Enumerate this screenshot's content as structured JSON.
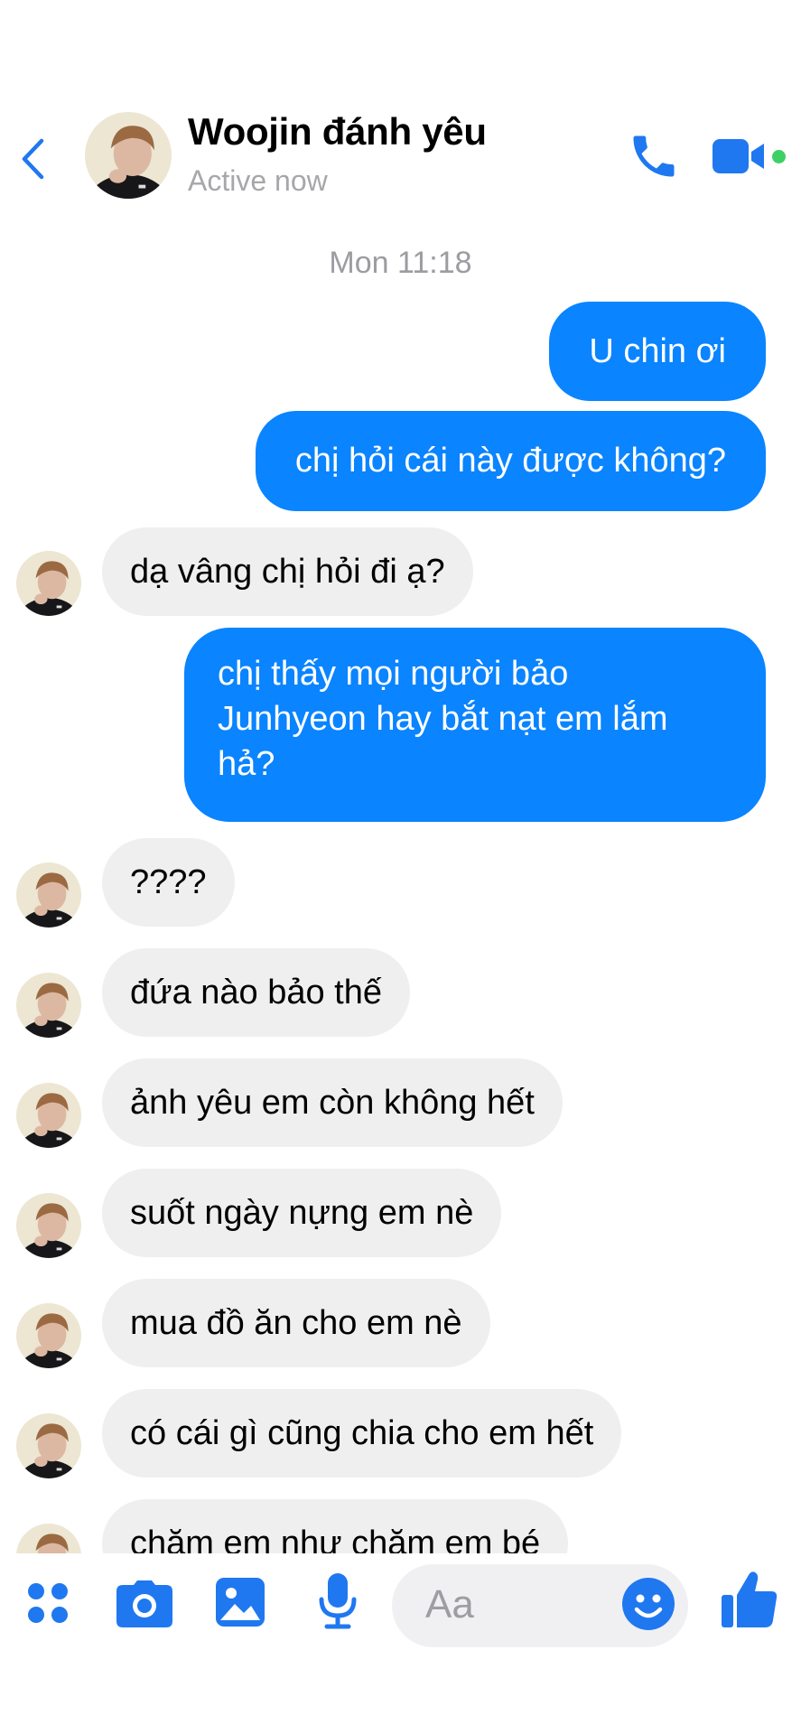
{
  "header": {
    "back_icon": "chevron-left-icon",
    "contact_name": "Woojin đánh yêu",
    "status": "Active now",
    "call_icon": "phone-icon",
    "video_icon": "video-camera-icon",
    "online": true
  },
  "thread": {
    "timestamp": "Mon 11:18",
    "messages": [
      {
        "from": "me",
        "text": "U chin ơi"
      },
      {
        "from": "me",
        "text": "chị hỏi cái này được không?"
      },
      {
        "from": "them",
        "text": "dạ vâng chị hỏi đi ạ?"
      },
      {
        "from": "me",
        "lines": [
          "chị thấy mọi người bảo",
          "Junhyeon hay bắt nạt em lắm",
          "hả?"
        ]
      },
      {
        "from": "them",
        "text": "????"
      },
      {
        "from": "them",
        "text": "đứa nào bảo thế"
      },
      {
        "from": "them",
        "text": "ảnh yêu em còn không hết"
      },
      {
        "from": "them",
        "text": "suốt ngày nựng em nè"
      },
      {
        "from": "them",
        "text": "mua đồ ăn cho em nè"
      },
      {
        "from": "them",
        "text": "có cái gì cũng chia cho em hết"
      },
      {
        "from": "them",
        "text": "chăm em như chăm em bé"
      }
    ]
  },
  "composer": {
    "placeholder": "Aa",
    "icons": [
      "apps-grid-icon",
      "camera-icon",
      "photo-gallery-icon",
      "microphone-icon",
      "emoji-icon",
      "thumbs-up-icon"
    ]
  },
  "colors": {
    "accent": "#0a84ff",
    "icon_blue": "#1f78f0",
    "incoming_bubble": "#efeff0",
    "online_green": "#3ed065"
  }
}
